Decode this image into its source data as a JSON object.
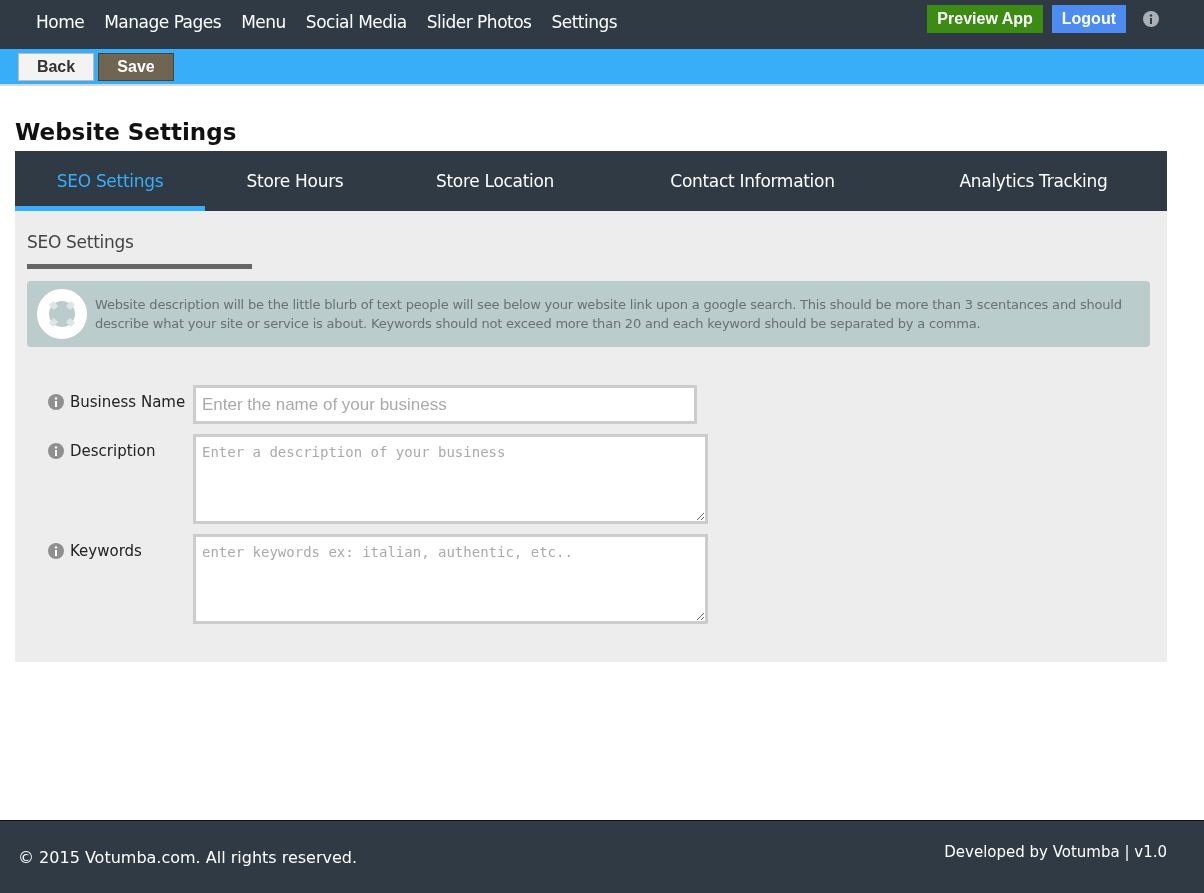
{
  "nav": {
    "items": [
      "Home",
      "Manage Pages",
      "Menu",
      "Social Media",
      "Slider Photos",
      "Settings"
    ],
    "preview_button": "Preview App",
    "logout_button": "Logout"
  },
  "toolbar": {
    "buttons": [
      {
        "label": "Back",
        "kind": "plain"
      },
      {
        "label": "Save",
        "kind": "dark"
      }
    ]
  },
  "page_title": "Website Settings",
  "tabs": [
    {
      "label": "SEO Settings",
      "selected": true
    },
    {
      "label": "Store Hours",
      "selected": false
    },
    {
      "label": "Store Location",
      "selected": false
    },
    {
      "label": "Contact Information",
      "selected": false
    },
    {
      "label": "Analytics Tracking",
      "selected": false
    }
  ],
  "section_title": "SEO Settings",
  "help_text": "Website description will be the little blurb of text people will see below your website link upon a google search. This should be more than 3 scentances and should describe what your site or service is about. Keywords should not exceed more than 20 and each keyword should be separated by a comma.",
  "fields": [
    {
      "label": "Business Name",
      "kind": "input",
      "placeholder": "Enter the name of your business"
    },
    {
      "label": "Description",
      "kind": "textarea",
      "placeholder": "Enter a description of your business"
    },
    {
      "label": "Keywords",
      "kind": "textarea",
      "placeholder": "enter keywords ex: italian, authentic, etc.."
    }
  ],
  "footer": {
    "copyright": "© 2015 Votumba.com. All rights reserved.",
    "credit": "Developed by Votumba | v1.0"
  }
}
